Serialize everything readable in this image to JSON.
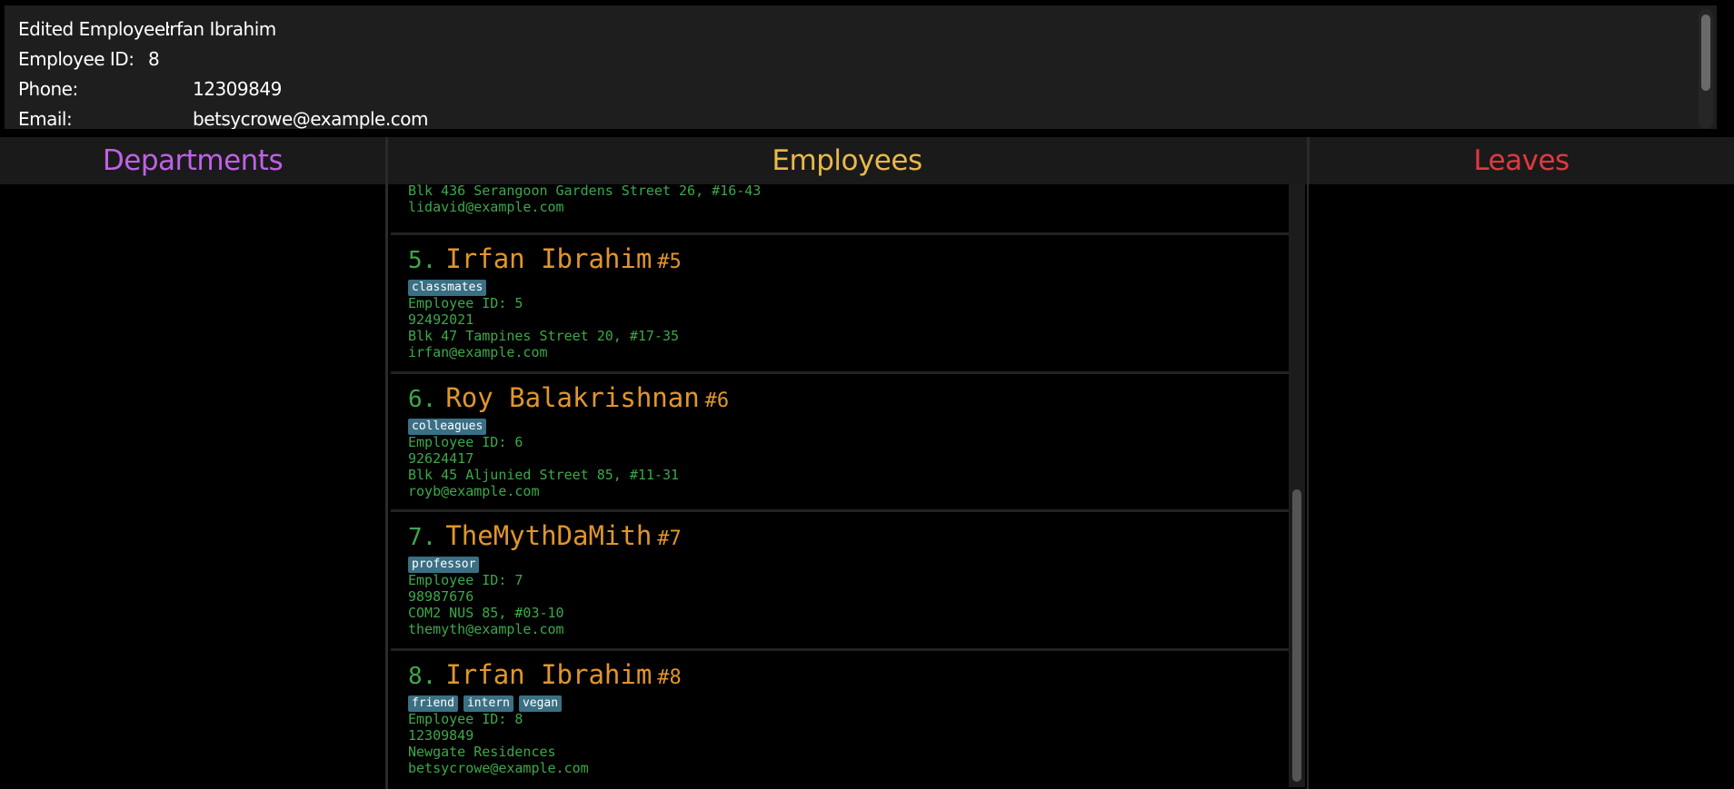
{
  "result": {
    "lines": [
      {
        "label": "Edited Employee:",
        "value": "Irfan Ibrahim"
      },
      {
        "label": "Employee ID:",
        "value": "8"
      },
      {
        "label": "Phone:",
        "value": "12309849"
      },
      {
        "label": "Email:",
        "value": "betsycrowe@example.com"
      }
    ]
  },
  "columns": {
    "departments": "Departments",
    "employees": "Employees",
    "leaves": "Leaves"
  },
  "employees": {
    "partial": {
      "address": "Blk 436 Serangoon Gardens Street 26, #16-43",
      "email": "lidavid@example.com"
    },
    "cards": [
      {
        "index": "5.",
        "name": "Irfan Ibrahim",
        "hash": "#5",
        "tags": [
          "classmates"
        ],
        "employee_id": "Employee ID: 5",
        "phone": "92492021",
        "address": "Blk 47 Tampines Street 20, #17-35",
        "email": "irfan@example.com"
      },
      {
        "index": "6.",
        "name": "Roy Balakrishnan",
        "hash": "#6",
        "tags": [
          "colleagues"
        ],
        "employee_id": "Employee ID: 6",
        "phone": "92624417",
        "address": "Blk 45 Aljunied Street 85, #11-31",
        "email": "royb@example.com"
      },
      {
        "index": "7.",
        "name": "TheMythDaMith",
        "hash": "#7",
        "tags": [
          "professor"
        ],
        "employee_id": "Employee ID: 7",
        "phone": "98987676",
        "address": "COM2 NUS 85, #03-10",
        "email": "themyth@example.com"
      },
      {
        "index": "8.",
        "name": "Irfan Ibrahim",
        "hash": "#8",
        "tags": [
          "friend",
          "intern",
          "vegan"
        ],
        "employee_id": "Employee ID: 8",
        "phone": "12309849",
        "address": "Newgate Residences",
        "email": "betsycrowe@example.com"
      }
    ]
  },
  "colors": {
    "departments_header": "#c061e6",
    "employees_header": "#e8b94a",
    "leaves_header": "#e0393f",
    "name": "#e0962b",
    "field": "#3da84a",
    "tag_bg": "#3b6f83"
  }
}
